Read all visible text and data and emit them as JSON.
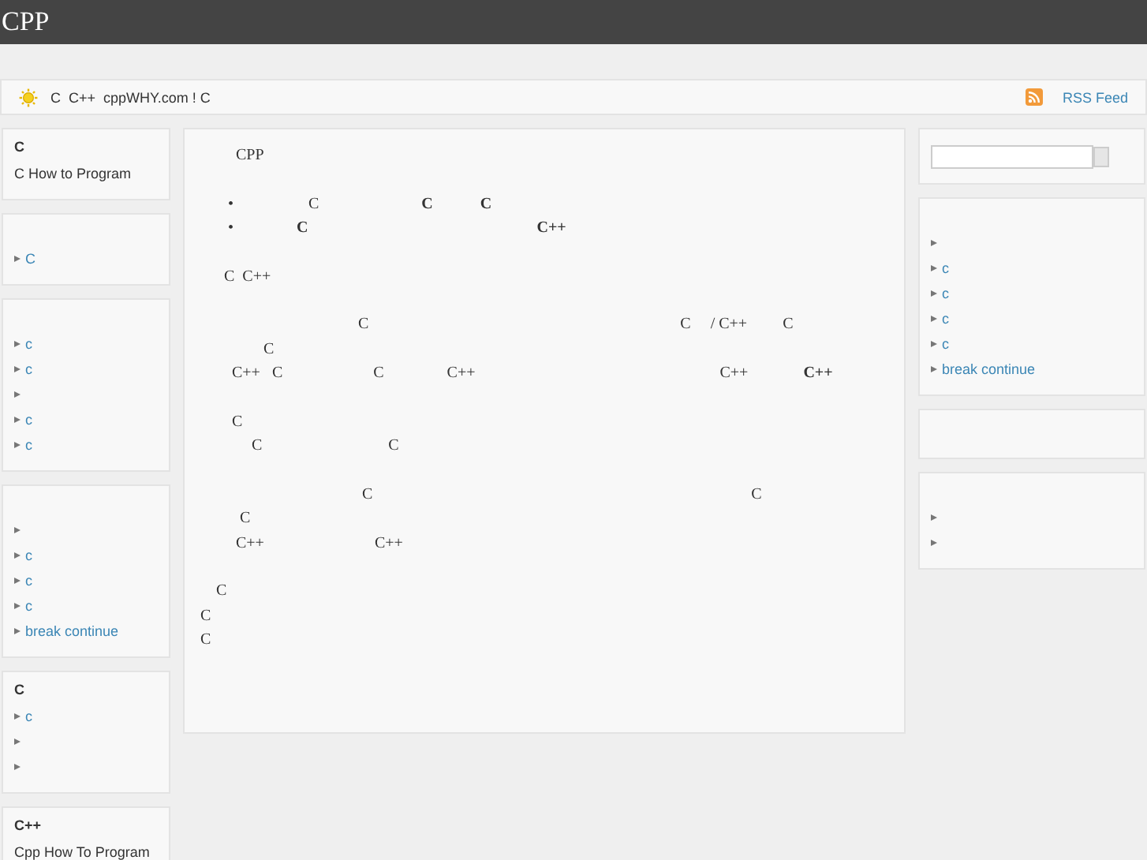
{
  "header": {
    "title": "CPP"
  },
  "notice": {
    "text": "C  C++  cppWHY.com ! C",
    "link": "RSS Feed"
  },
  "left_boxes": [
    {
      "title": "C",
      "lines": [
        "C How to Program"
      ]
    },
    {
      "items": [
        {
          "kind": "link",
          "label": "C"
        }
      ]
    },
    {
      "items": [
        {
          "kind": "link",
          "label": "c"
        },
        {
          "kind": "link",
          "label": "c"
        },
        {
          "kind": "blank"
        },
        {
          "kind": "link",
          "label": "c"
        },
        {
          "kind": "link",
          "label": "c"
        }
      ]
    },
    {
      "items": [
        {
          "kind": "blank"
        },
        {
          "kind": "link",
          "label": "c"
        },
        {
          "kind": "link",
          "label": "c"
        },
        {
          "kind": "link",
          "label": "c"
        },
        {
          "kind": "link",
          "label": "break continue"
        }
      ]
    },
    {
      "title": "C",
      "items": [
        {
          "kind": "link",
          "label": "c"
        },
        {
          "kind": "blank"
        },
        {
          "kind": "blank"
        }
      ]
    },
    {
      "title": "C++",
      "lines": [
        "Cpp How To Program"
      ]
    }
  ],
  "article": {
    "paragraphs": [
      [
        "         CPP"
      ],
      [
        "       •                   C                          **C**            **C**",
        "       •                **C**                                                          **C++**"
      ],
      [
        "      C  C++"
      ],
      [
        "                                        C                                                                               C     / C++         C",
        "                C",
        "        C++   C                       C                C++                                                              C++              **C++**"
      ],
      [
        "        C",
        "             C                                C"
      ],
      [
        "                                         C                                                                                                C",
        "          C",
        "         C++                            C++"
      ],
      [
        "    C",
        "C",
        "C"
      ]
    ]
  },
  "right_boxes": [
    {
      "kind": "search"
    },
    {
      "kind": "list",
      "items": [
        {
          "kind": "blank"
        },
        {
          "kind": "link",
          "label": "c"
        },
        {
          "kind": "link",
          "label": "c"
        },
        {
          "kind": "link",
          "label": "c"
        },
        {
          "kind": "link",
          "label": "c"
        },
        {
          "kind": "link",
          "label": "break continue"
        }
      ]
    },
    {
      "kind": "empty"
    },
    {
      "kind": "list",
      "items": [
        {
          "kind": "blank"
        },
        {
          "kind": "blank"
        }
      ]
    }
  ]
}
